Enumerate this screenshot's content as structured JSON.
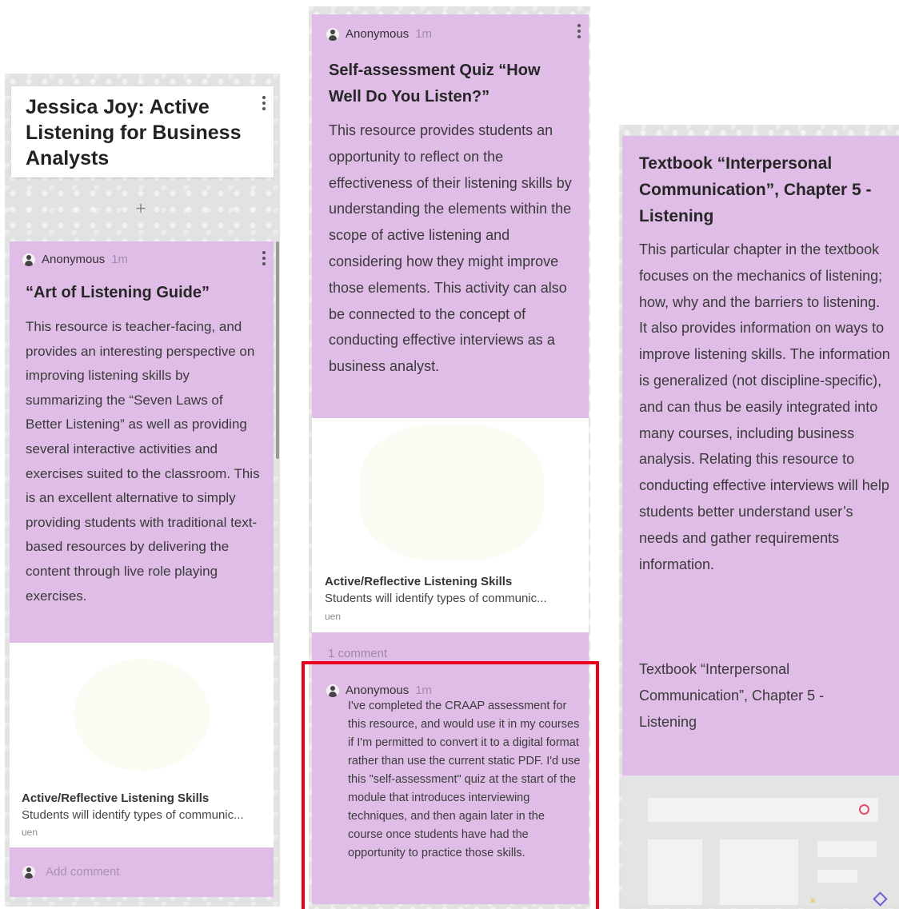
{
  "column1": {
    "section_title": "Jessica Joy: Active Listening for Business Analysts",
    "add_button": "+",
    "post": {
      "author": "Anonymous",
      "time": "1m",
      "title": "“Art of Listening Guide”",
      "body": "This resource is teacher-facing, and provides an interesting perspective on improving listening skills by summarizing the “Seven Laws of Better Listening” as well as providing several interactive activities and exercises suited to the classroom. This is an excellent alternative to simply providing students with traditional text-based resources by delivering the content through live role playing exercises.",
      "link": {
        "title": "Active/Reflective Listening Skills",
        "description": "Students will identify types of communic...",
        "source": "uen"
      },
      "add_comment_placeholder": "Add comment"
    }
  },
  "column2": {
    "post": {
      "author": "Anonymous",
      "time": "1m",
      "title": "Self-assessment Quiz “How Well Do You Listen?”",
      "body": "This resource provides students an opportunity to reflect on the effectiveness of their listening skills by understanding the elements within the scope of active listening and considering how they might improve those elements. This activity can also be connected to the concept of conducting effective interviews as a business analyst.",
      "link": {
        "title": "Active/Reflective Listening Skills",
        "description": "Students will identify types of communic...",
        "source": "uen"
      },
      "comment_count": "1 comment",
      "comment": {
        "author": "Anonymous",
        "time": "1m",
        "text": "I've completed the CRAAP assessment for this resource, and would use it in my courses if I'm permitted to convert it to a digital format rather than use the current static PDF. I'd use this \"self-assessment\" quiz at the start of the module that introduces interviewing techniques, and then again later in the course once students have had the opportunity to practice those skills."
      }
    }
  },
  "column3": {
    "post": {
      "title": "Textbook “Interpersonal Communication”, Chapter 5 - Listening",
      "body": "This particular chapter in the textbook focuses on the mechanics of listening; how, why and the barriers to listening. It also provides information on ways to improve listening skills. The information is generalized (not discipline-specific), and can thus be easily integrated into many courses, including business analysis. Relating this resource to conducting effective interviews will help students better understand user’s needs and gather requirements information.",
      "attachment_name": "Textbook “Interpersonal Communication”, Chapter 5 - Listening"
    }
  },
  "colors": {
    "card": "#dfbde6",
    "highlight": "#e8001c",
    "wall": "#e2e2e2"
  },
  "icons": [
    "menu-dots-icon",
    "avatar-icon",
    "plus-icon",
    "circle-icon",
    "diamond-icon",
    "cross-icon"
  ]
}
